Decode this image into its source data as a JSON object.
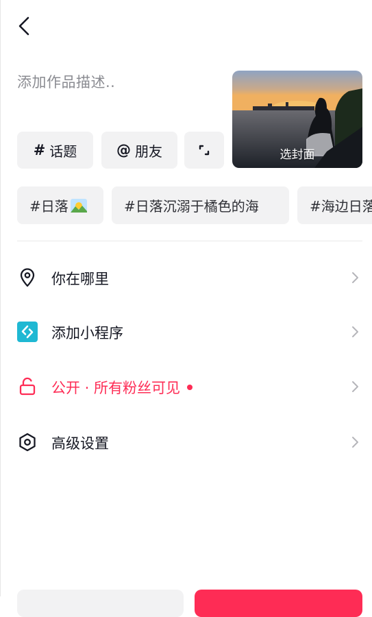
{
  "description": {
    "placeholder": "添加作品描述.."
  },
  "cover": {
    "label": "选封面"
  },
  "chips": [
    {
      "symbol": "#",
      "label": "话题",
      "icon": "hashtag-icon"
    },
    {
      "symbol": "@",
      "label": "朋友",
      "icon": "at-icon"
    },
    {
      "icon": "expand-frame-icon"
    }
  ],
  "tags": [
    {
      "label": "#日落",
      "emoji_icon": "sunrise-over-mountains-icon"
    },
    {
      "label": "#日落沉溺于橘色的海"
    },
    {
      "label": "#海边日落"
    }
  ],
  "menu": [
    {
      "label": "你在哪里",
      "icon": "location-pin-icon"
    },
    {
      "label": "添加小程序",
      "icon": "mini-program-icon"
    },
    {
      "label": "公开 · 所有粉丝可见",
      "icon": "unlock-icon"
    },
    {
      "label": "高级设置",
      "icon": "hexagon-settings-icon"
    }
  ],
  "colors": {
    "accent": "#fe2c55",
    "mini_program": "#1fb8d3",
    "chip_bg": "#f2f2f3",
    "placeholder": "#8a8b91"
  }
}
